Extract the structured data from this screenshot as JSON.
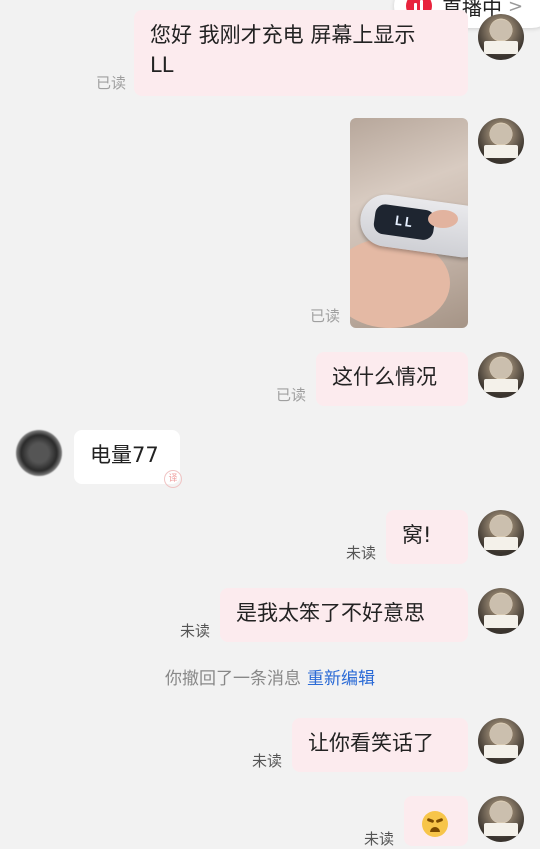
{
  "header": {
    "live_label": "直播中",
    "live_chevron": ">"
  },
  "messages": [
    {
      "id": "m1",
      "text_line1": "您好 我刚才充电 屏幕上显示",
      "text_line2": "LL",
      "status": "已读"
    },
    {
      "id": "m2",
      "type": "image",
      "image_caption": "LL",
      "status": "已读"
    },
    {
      "id": "m3",
      "text": "这什么情况",
      "status": "已读"
    },
    {
      "id": "m4",
      "text": "电量77",
      "from": "other"
    },
    {
      "id": "m5",
      "text": "窝!",
      "status": "未读"
    },
    {
      "id": "m6",
      "text": "是我太笨了不好意思",
      "status": "未读"
    },
    {
      "id": "m7",
      "text": "让你看笑话了",
      "status": "未读"
    },
    {
      "id": "m8",
      "type": "emoji",
      "emoji": "persevering-face-emoji",
      "status": "未读"
    }
  ],
  "recall": {
    "text": "你撤回了一条消息",
    "action": "重新编辑"
  },
  "colors": {
    "outgoing_bubble": "#fcebee",
    "incoming_bubble": "#ffffff",
    "link": "#2b6bd6",
    "live_red": "#e8243d"
  }
}
